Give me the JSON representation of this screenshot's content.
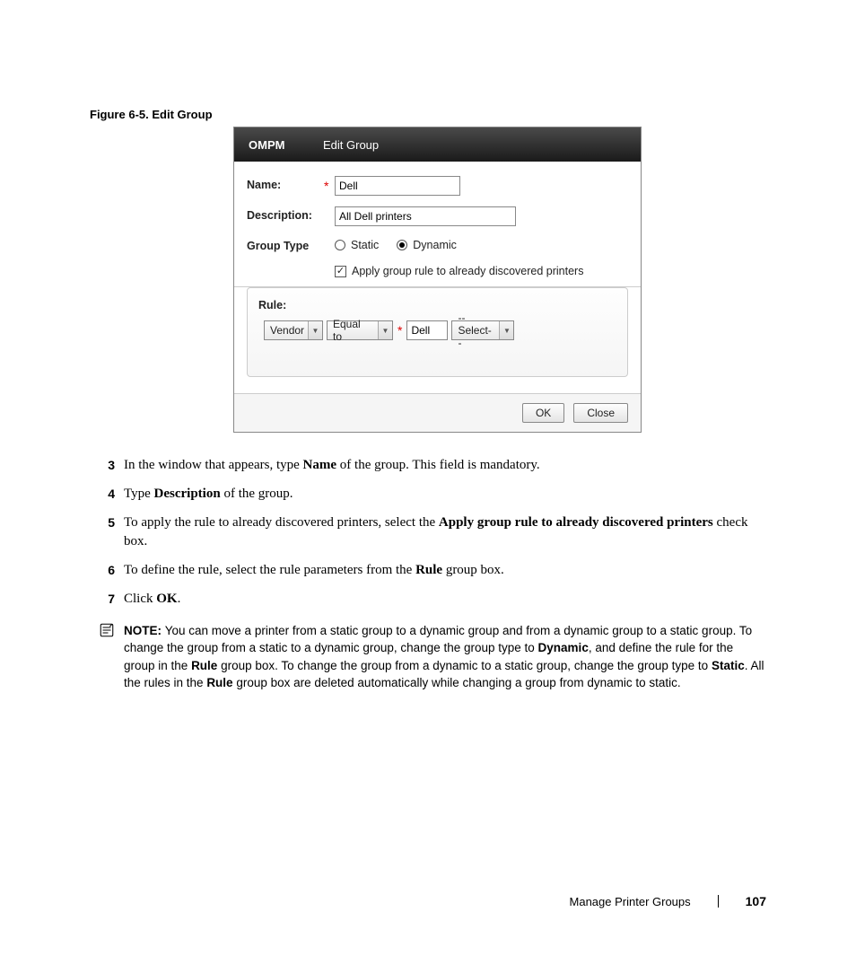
{
  "figure_caption": "Figure 6-5.    Edit Group",
  "dialog": {
    "app_name": "OMPM",
    "title": "Edit Group",
    "labels": {
      "name": "Name:",
      "description": "Description:",
      "group_type": "Group Type",
      "rule": "Rule:"
    },
    "fields": {
      "name_value": "Dell",
      "description_value": "All Dell printers"
    },
    "group_type": {
      "static_label": "Static",
      "dynamic_label": "Dynamic",
      "selected": "Dynamic",
      "apply_rule_label": "Apply group rule to already discovered printers",
      "apply_rule_checked": true
    },
    "rule": {
      "field_dropdown": "Vendor",
      "operator_dropdown": "Equal to",
      "value": "Dell",
      "extra_dropdown": "--Select--"
    },
    "buttons": {
      "ok": "OK",
      "close": "Close"
    },
    "checkmark_glyph": "✓",
    "required_glyph": "*"
  },
  "steps": {
    "s3": {
      "n": "3",
      "pre": "In the window that appears, type ",
      "b1": "Name",
      "post": " of the group. This field is mandatory."
    },
    "s4": {
      "n": "4",
      "pre": "Type ",
      "b1": "Description",
      "post": " of the group."
    },
    "s5": {
      "n": "5",
      "pre": "To apply the rule to already discovered printers, select the ",
      "b1": "Apply group rule to already discovered printers",
      "post": " check box."
    },
    "s6": {
      "n": "6",
      "pre": "To define the rule, select the rule parameters from the ",
      "b1": "Rule",
      "post": " group box."
    },
    "s7": {
      "n": "7",
      "pre": "Click ",
      "b1": "OK",
      "post": "."
    }
  },
  "note": {
    "label": "NOTE: ",
    "t1": "You can move a printer from a static group to a dynamic group and from a dynamic group to a static group. To change the group from a static to a dynamic group, change the group type to ",
    "b1": "Dynamic",
    "t2": ", and define the rule for the group in the ",
    "b2": "Rule",
    "t3": " group box. To change the group from a dynamic to a static group, change the group type to ",
    "b3": "Static",
    "t4": ". All the rules in the ",
    "b4": "Rule",
    "t5": " group box are deleted automatically while changing a group from dynamic to static."
  },
  "footer": {
    "section": "Manage Printer Groups",
    "page": "107"
  }
}
